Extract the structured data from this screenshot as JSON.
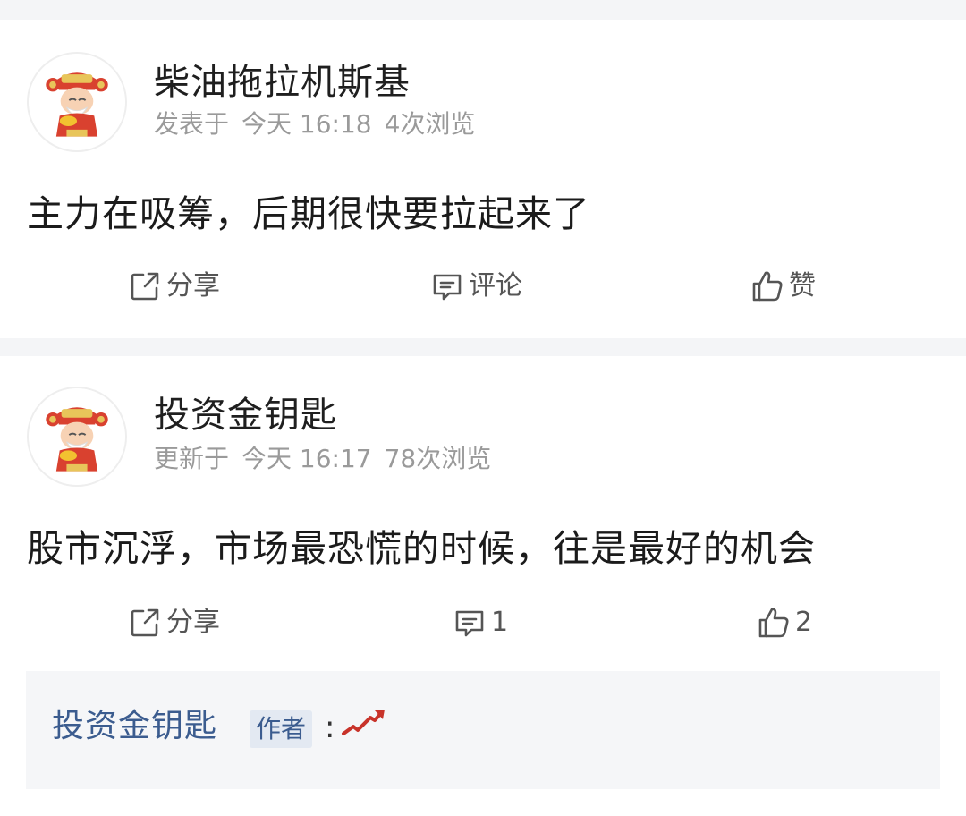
{
  "posts": [
    {
      "username": "柴油拖拉机斯基",
      "meta_action": "发表于",
      "meta_time": "今天 16:18",
      "meta_views": "4次浏览",
      "content": "主力在吸筹，后期很快要拉起来了",
      "actions": {
        "share": "分享",
        "comment": "评论",
        "like": "赞"
      },
      "avatar_icon": "god-of-wealth-avatar"
    },
    {
      "username": "投资金钥匙",
      "meta_action": "更新于",
      "meta_time": "今天 16:17",
      "meta_views": "78次浏览",
      "content": "股市沉浮，市场最恐慌的时候，往是最好的机会",
      "actions": {
        "share": "分享",
        "comment": "1",
        "like": "2"
      },
      "avatar_icon": "god-of-wealth-avatar",
      "reply": {
        "author": "投资金钥匙",
        "tag": "作者",
        "colon": ":",
        "emoji_icon": "rising-chart-icon"
      }
    }
  ],
  "colors": {
    "background": "#f4f5f7",
    "card": "#ffffff",
    "link_blue": "#3b5c8f",
    "meta_gray": "#9a9a9a"
  }
}
